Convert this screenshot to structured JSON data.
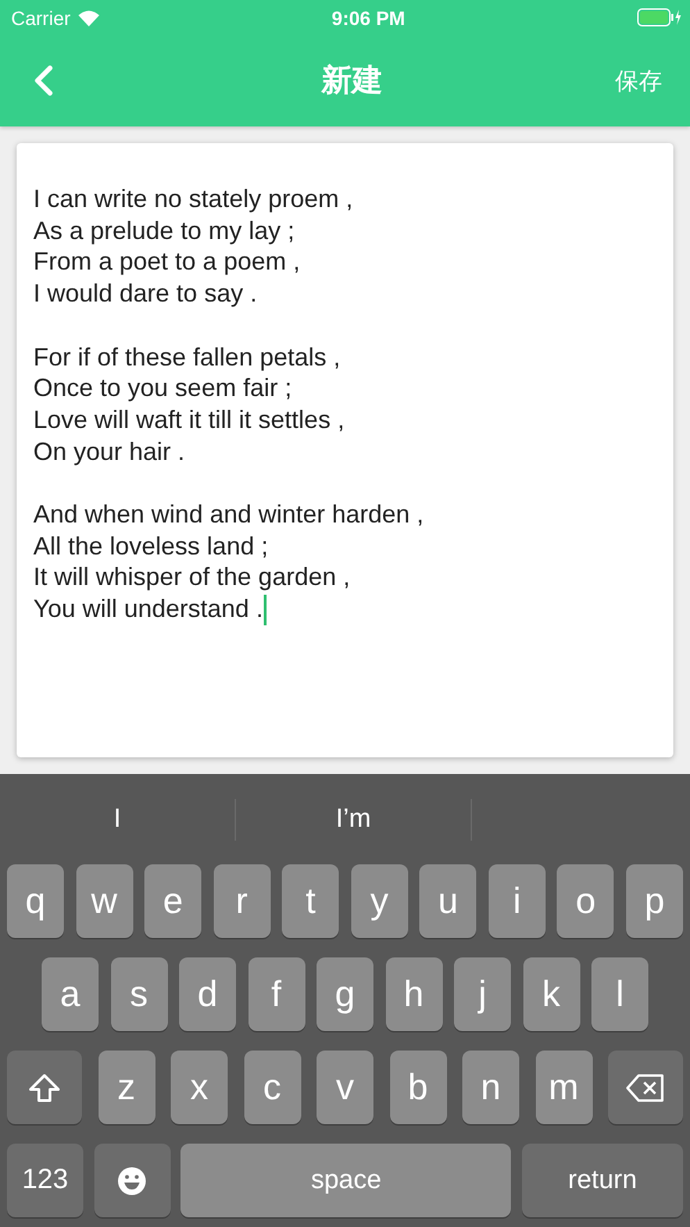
{
  "status_bar": {
    "carrier": "Carrier",
    "time": "9:06 PM"
  },
  "nav": {
    "title": "新建",
    "action": "保存"
  },
  "editor": {
    "stanzas": [
      [
        "I can write no stately proem ,",
        "As a prelude to my lay ;",
        "From a poet to a poem ,",
        "I would dare to say ."
      ],
      [
        "For if of these fallen petals ,",
        "Once to you seem fair ;",
        "Love will waft it till it settles ,",
        "On your hair ."
      ],
      [
        "And when wind and winter harden ,",
        "All the loveless land ;",
        "It will whisper of the garden ,",
        "You will understand ."
      ]
    ]
  },
  "keyboard": {
    "suggestions": [
      "I",
      "I’m"
    ],
    "top_row": [
      {
        "kind": "letter",
        "label": "q"
      },
      {
        "kind": "letter",
        "label": "w"
      },
      {
        "kind": "letter",
        "label": "e"
      },
      {
        "kind": "letter",
        "label": "r"
      },
      {
        "kind": "letter",
        "label": "t"
      },
      {
        "kind": "letter",
        "label": "y"
      },
      {
        "kind": "letter",
        "label": "u"
      },
      {
        "kind": "letter",
        "label": "i"
      },
      {
        "kind": "letter",
        "label": "o"
      },
      {
        "kind": "letter",
        "label": "p"
      }
    ],
    "home_row": [
      {
        "kind": "letter",
        "label": "a"
      },
      {
        "kind": "letter",
        "label": "s"
      },
      {
        "kind": "letter",
        "label": "d"
      },
      {
        "kind": "letter",
        "label": "f"
      },
      {
        "kind": "letter",
        "label": "g"
      },
      {
        "kind": "letter",
        "label": "h"
      },
      {
        "kind": "letter",
        "label": "j"
      },
      {
        "kind": "letter",
        "label": "k"
      },
      {
        "kind": "letter",
        "label": "l"
      }
    ],
    "lower_row": [
      {
        "kind": "shift"
      },
      {
        "kind": "letter",
        "label": "z"
      },
      {
        "kind": "letter",
        "label": "x"
      },
      {
        "kind": "letter",
        "label": "c"
      },
      {
        "kind": "letter",
        "label": "v"
      },
      {
        "kind": "letter",
        "label": "b"
      },
      {
        "kind": "letter",
        "label": "n"
      },
      {
        "kind": "letter",
        "label": "m"
      },
      {
        "kind": "delete"
      }
    ],
    "function_row": [
      {
        "kind": "numbers",
        "label": "123"
      },
      {
        "kind": "emoji"
      },
      {
        "kind": "space",
        "label": "space"
      },
      {
        "kind": "return",
        "label": "return"
      }
    ]
  }
}
